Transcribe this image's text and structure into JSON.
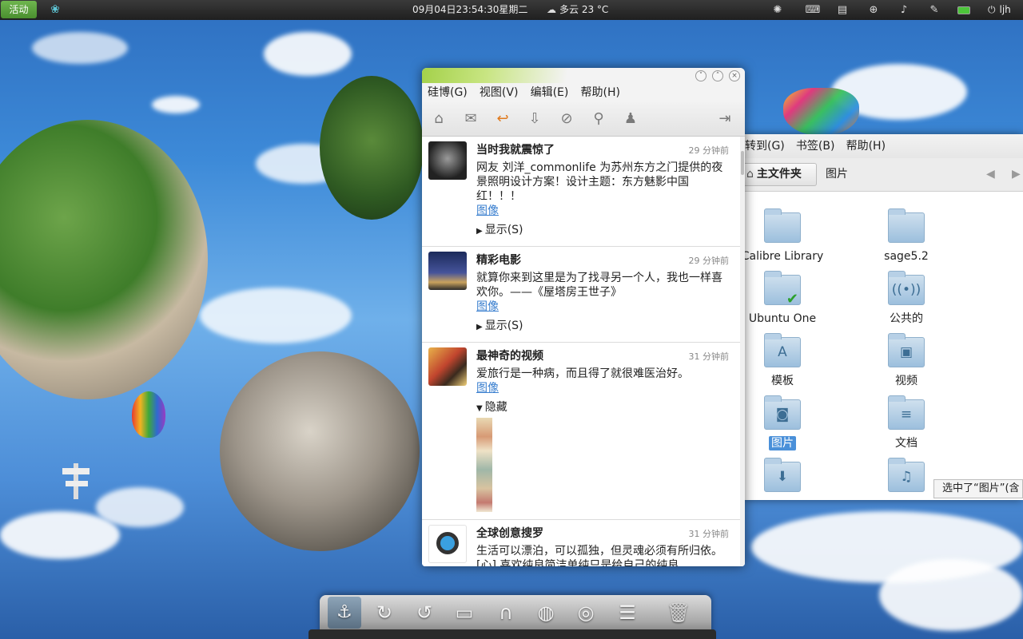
{
  "top_panel": {
    "activities": "活动",
    "clock": "09月04日23:54:30星期二",
    "weather": "多云 23 °C",
    "user": "ljh"
  },
  "weibo": {
    "menu": [
      "硅博(G)",
      "视图(V)",
      "编辑(E)",
      "帮助(H)"
    ],
    "toolbar_icons": [
      "home-icon",
      "mail-icon",
      "reply-icon",
      "favorites-icon",
      "tag-icon",
      "search-icon",
      "user-icon",
      "logout-icon"
    ],
    "posts": [
      {
        "author": "当时我就震惊了",
        "time": "29 分钟前",
        "text": "网友 刘洋_commonlife 为苏州东方之门提供的夜景照明设计方案！设计主题：东方魅影中国红！！！",
        "link": "图像",
        "toggle": "显示(S)"
      },
      {
        "author": "精彩电影",
        "time": "29 分钟前",
        "text": "就算你来到这里是为了找寻另一个人，我也一样喜欢你。——《屋塔房王世子》",
        "link": "图像",
        "toggle": "显示(S)"
      },
      {
        "author": "最神奇的视频",
        "time": "31 分钟前",
        "text": "爱旅行是一种病，而且得了就很难医治好。",
        "link": "图像",
        "toggle": "隐藏"
      },
      {
        "author": "全球创意搜罗",
        "time": "31 分钟前",
        "text": "生活可以漂泊，可以孤独，但灵魂必须有所归依。[心] 喜欢纯良简洁单纯只是给自己的纯良"
      }
    ]
  },
  "file_manager": {
    "menu": [
      "转到(G)",
      "书签(B)",
      "帮助(H)"
    ],
    "path_home": "主文件夹",
    "path_current": "图片",
    "items": [
      "Calibre Library",
      "sage5.2",
      "Ubuntu One",
      "公共的",
      "模板",
      "视频",
      "图片",
      "文档",
      "",
      ""
    ],
    "status": "选中了“图片”(含"
  }
}
